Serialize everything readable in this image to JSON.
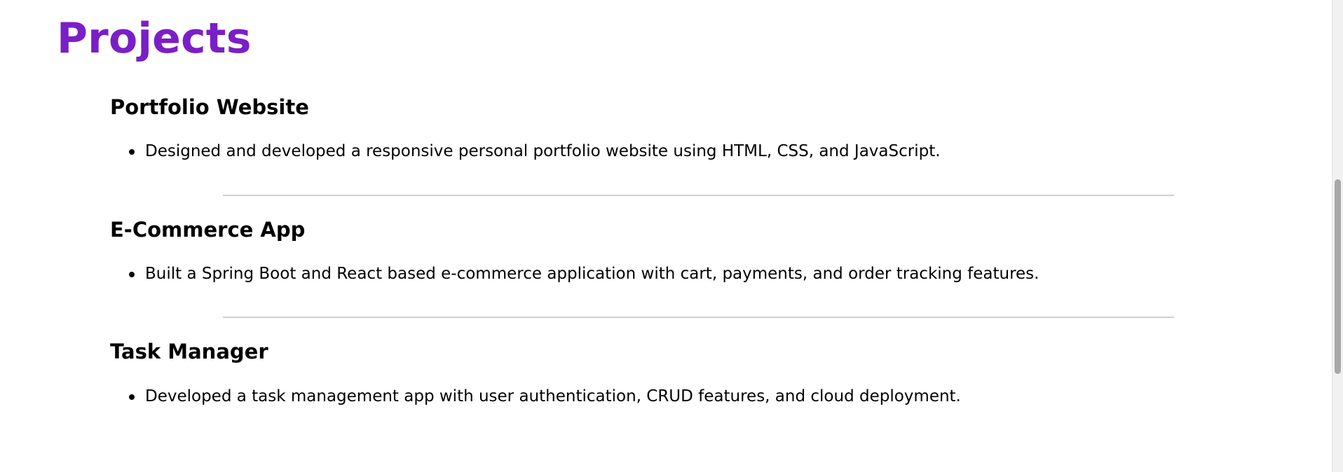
{
  "section": {
    "title": "Projects"
  },
  "projects": [
    {
      "title": "Portfolio Website",
      "bullets": [
        "Designed and developed a responsive personal portfolio website using HTML, CSS, and JavaScript."
      ]
    },
    {
      "title": "E-Commerce App",
      "bullets": [
        "Built a Spring Boot and React based e-commerce application with cart, payments, and order tracking features."
      ]
    },
    {
      "title": "Task Manager",
      "bullets": [
        "Developed a task management app with user authentication, CRUD features, and cloud deployment."
      ]
    }
  ],
  "colors": {
    "heading": "#7a1fc7",
    "divider": "#cfcfcf",
    "scrollbar_thumb": "#a8a8a8"
  }
}
